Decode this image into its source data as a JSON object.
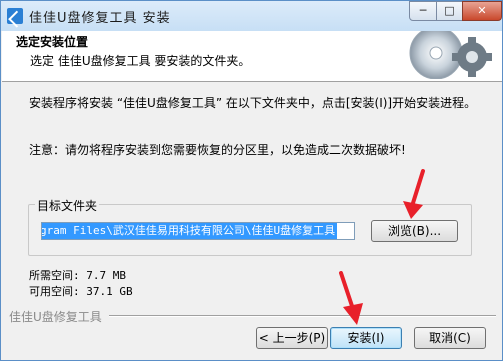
{
  "window": {
    "title": "佳佳U盘修复工具 安装",
    "min_label": "─",
    "max_label": "□",
    "close_label": "✕"
  },
  "header": {
    "title": "选定安装位置",
    "subtitle": "选定 佳佳U盘修复工具 要安装的文件夹。"
  },
  "body": {
    "line1": "安装程序将安装 “佳佳U盘修复工具” 在以下文件夹中，点击[安装(I)]开始安装进程。",
    "line2": "注意：请勿将程序安装到您需要恢复的分区里，以免造成二次数据破坏!"
  },
  "target": {
    "group_label": "目标文件夹",
    "path_value": "gram Files\\武汉佳佳易用科技有限公司\\佳佳U盘修复工具",
    "browse_label": "浏览(B)..."
  },
  "space": {
    "required": "所需空间: 7.7 MB",
    "available": "可用空间: 37.1 GB"
  },
  "footer": {
    "brand": "佳佳U盘修复工具",
    "back_label": "< 上一步(P)",
    "install_label": "安装(I)",
    "cancel_label": "取消(C)"
  },
  "colors": {
    "selection": "#3399ff",
    "arrow": "#e8202a",
    "title_bar": "#c7dff5"
  },
  "icons": [
    "installer-app-icon",
    "cd-gear-art",
    "annotation-arrow"
  ]
}
